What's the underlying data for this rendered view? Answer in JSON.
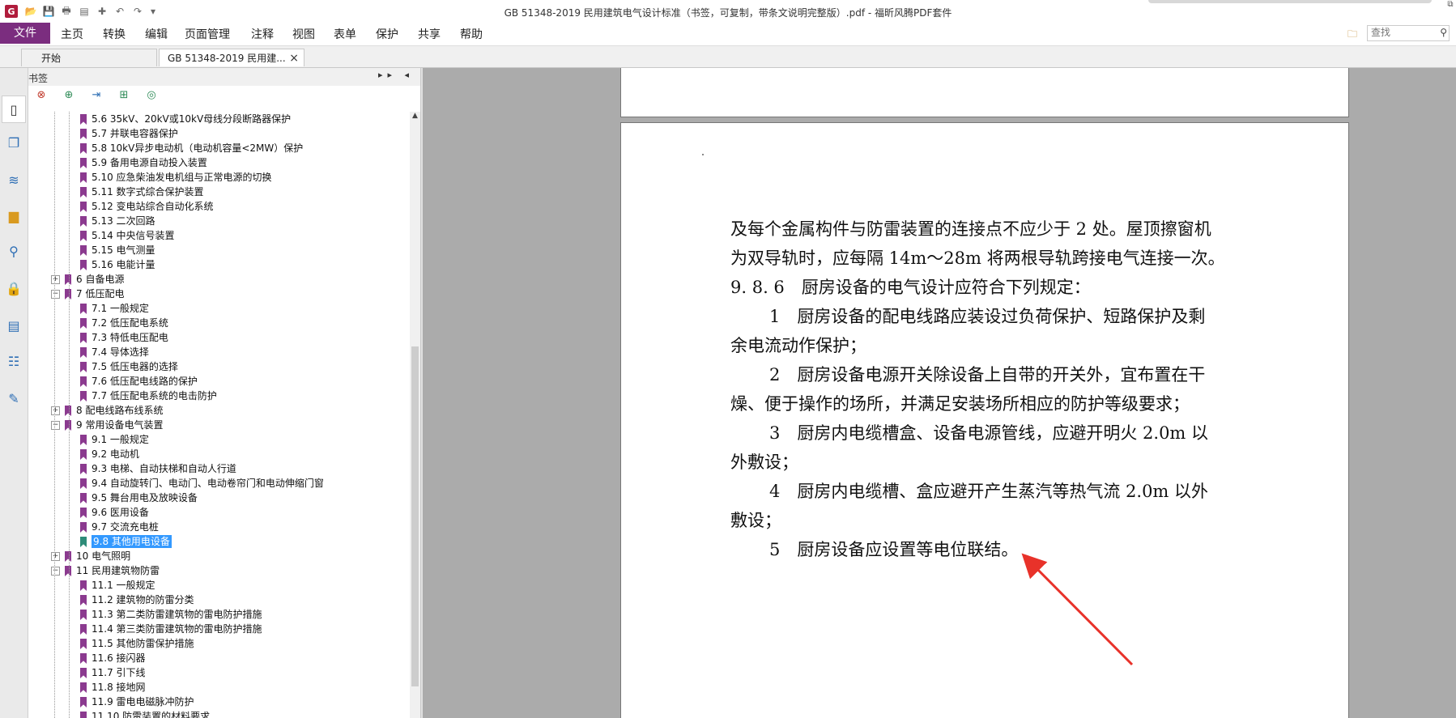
{
  "window": {
    "title": "GB 51348-2019 民用建筑电气设计标准（书签，可复制，带条文说明完整版）.pdf - 福昕风腾PDF套件"
  },
  "quick_access": {
    "logo": "G",
    "icons": [
      "open-folder-icon",
      "save-icon",
      "print-icon",
      "scan-icon",
      "new-icon",
      "undo-icon",
      "redo-icon",
      "customize-icon"
    ]
  },
  "menu": {
    "file": "文件",
    "items": [
      "主页",
      "转换",
      "编辑",
      "页面管理",
      "注释",
      "视图",
      "表单",
      "保护",
      "共享",
      "帮助"
    ]
  },
  "search": {
    "placeholder": "查找"
  },
  "tabs": {
    "start": "开始",
    "doc": "GB 51348-2019 民用建..."
  },
  "panel": {
    "title": "书签",
    "controls": "▸▸ ◂"
  },
  "bookmarks": [
    {
      "level": 2,
      "label": "5.6 35kV、20kV或10kV母线分段断路器保护"
    },
    {
      "level": 2,
      "label": "5.7 并联电容器保护"
    },
    {
      "level": 2,
      "label": "5.8 10kV异步电动机（电动机容量<2MW）保护"
    },
    {
      "level": 2,
      "label": "5.9 备用电源自动投入装置"
    },
    {
      "level": 2,
      "label": "5.10 应急柴油发电机组与正常电源的切换"
    },
    {
      "level": 2,
      "label": "5.11 数字式综合保护装置"
    },
    {
      "level": 2,
      "label": "5.12 变电站综合自动化系统"
    },
    {
      "level": 2,
      "label": "5.13 二次回路"
    },
    {
      "level": 2,
      "label": "5.14 中央信号装置"
    },
    {
      "level": 2,
      "label": "5.15 电气测量"
    },
    {
      "level": 2,
      "label": "5.16 电能计量"
    },
    {
      "level": 1,
      "label": "6 自备电源",
      "expander": "+"
    },
    {
      "level": 1,
      "label": "7 低压配电",
      "expander": "−"
    },
    {
      "level": 2,
      "label": "7.1 一般规定"
    },
    {
      "level": 2,
      "label": "7.2 低压配电系统"
    },
    {
      "level": 2,
      "label": "7.3 特低电压配电"
    },
    {
      "level": 2,
      "label": "7.4 导体选择"
    },
    {
      "level": 2,
      "label": "7.5 低压电器的选择"
    },
    {
      "level": 2,
      "label": "7.6 低压配电线路的保护"
    },
    {
      "level": 2,
      "label": "7.7 低压配电系统的电击防护"
    },
    {
      "level": 1,
      "label": "8 配电线路布线系统",
      "expander": "+"
    },
    {
      "level": 1,
      "label": "9 常用设备电气装置",
      "expander": "−"
    },
    {
      "level": 2,
      "label": "9.1 一般规定"
    },
    {
      "level": 2,
      "label": "9.2 电动机"
    },
    {
      "level": 2,
      "label": "9.3 电梯、自动扶梯和自动人行道"
    },
    {
      "level": 2,
      "label": "9.4 自动旋转门、电动门、电动卷帘门和电动伸缩门窗"
    },
    {
      "level": 2,
      "label": "9.5 舞台用电及放映设备"
    },
    {
      "level": 2,
      "label": "9.6 医用设备"
    },
    {
      "level": 2,
      "label": "9.7 交流充电桩"
    },
    {
      "level": 2,
      "label": "9.8 其他用电设备",
      "selected": true
    },
    {
      "level": 1,
      "label": "10 电气照明",
      "expander": "+"
    },
    {
      "level": 1,
      "label": "11 民用建筑物防雷",
      "expander": "−"
    },
    {
      "level": 2,
      "label": "11.1 一般规定"
    },
    {
      "level": 2,
      "label": "11.2 建筑物的防雷分类"
    },
    {
      "level": 2,
      "label": "11.3 第二类防雷建筑物的雷电防护措施"
    },
    {
      "level": 2,
      "label": "11.4 第三类防雷建筑物的雷电防护措施"
    },
    {
      "level": 2,
      "label": "11.5 其他防雷保护措施"
    },
    {
      "level": 2,
      "label": "11.6 接闪器"
    },
    {
      "level": 2,
      "label": "11.7 引下线"
    },
    {
      "level": 2,
      "label": "11.8 接地网"
    },
    {
      "level": 2,
      "label": "11.9 雷电电磁脉冲防护"
    },
    {
      "level": 2,
      "label": "11.10 防雷装置的材料要求"
    }
  ],
  "document": {
    "lines": [
      {
        "text": "及每个金属构件与防雷装置的连接点不应少于 2 处。屋顶擦窗机",
        "indent": false
      },
      {
        "text": "为双导轨时，应每隔 14m～28m 将两根导轨跨接电气连接一次。",
        "indent": false
      },
      {
        "text": "9. 8. 6　厨房设备的电气设计应符合下列规定：",
        "indent": false,
        "bold_prefix": true
      },
      {
        "text": "1　厨房设备的配电线路应装设过负荷保护、短路保护及剩",
        "indent": true
      },
      {
        "text": "余电流动作保护；",
        "indent": false
      },
      {
        "text": "2　厨房设备电源开关除设备上自带的开关外，宜布置在干",
        "indent": true
      },
      {
        "text": "燥、便于操作的场所，并满足安装场所相应的防护等级要求；",
        "indent": false
      },
      {
        "text": "3　厨房内电缆槽盒、设备电源管线，应避开明火 2.0m 以",
        "indent": true
      },
      {
        "text": "外敷设；",
        "indent": false
      },
      {
        "text": "4　厨房内电缆槽、盒应避开产生蒸汽等热气流 2.0m 以外",
        "indent": true
      },
      {
        "text": "敷设；",
        "indent": false
      },
      {
        "text": "5　厨房设备应设置等电位联结。",
        "indent": true
      }
    ],
    "annotation_color": "#e8322a"
  },
  "colors": {
    "file_menu": "#7b2d7f",
    "bookmark": "#8b3a8f",
    "selection": "#3399ff",
    "canvas": "#ababab"
  }
}
